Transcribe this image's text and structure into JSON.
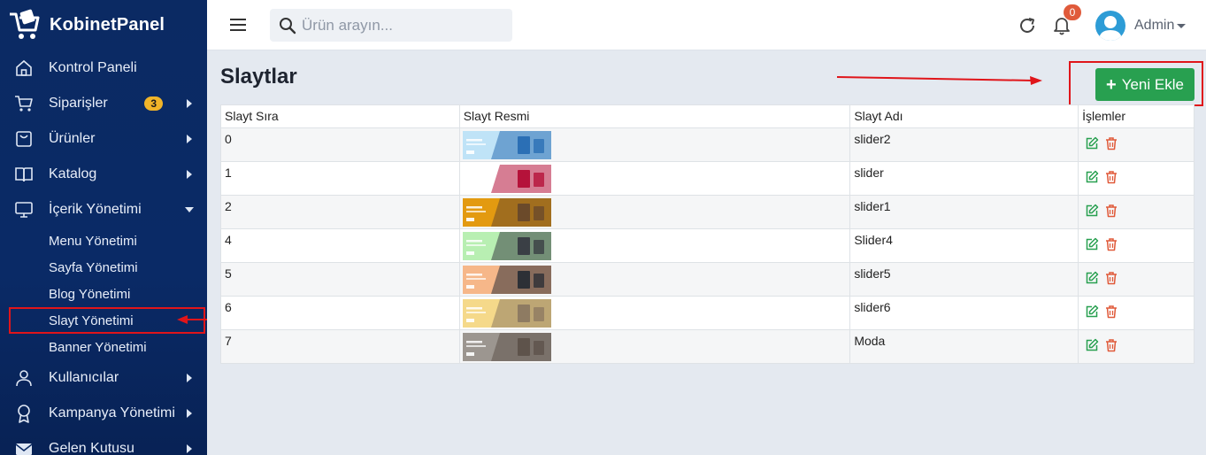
{
  "brand": {
    "name": "KobinetPanel"
  },
  "sidebar": {
    "items": [
      {
        "label": "Kontrol Paneli",
        "icon": "home-icon"
      },
      {
        "label": "Siparişler",
        "icon": "cart-icon",
        "badge": "3"
      },
      {
        "label": "Ürünler",
        "icon": "shopping-bag-icon"
      },
      {
        "label": "Katalog",
        "icon": "book-icon"
      },
      {
        "label": "İçerik Yönetimi",
        "icon": "monitor-icon",
        "expanded": true
      },
      {
        "label": "Kullanıcılar",
        "icon": "user-icon"
      },
      {
        "label": "Kampanya Yönetimi",
        "icon": "award-icon"
      },
      {
        "label": "Gelen Kutusu",
        "icon": "mail-icon"
      }
    ],
    "sub_items": [
      {
        "label": "Menu Yönetimi"
      },
      {
        "label": "Sayfa Yönetimi"
      },
      {
        "label": "Blog Yönetimi"
      },
      {
        "label": "Slayt Yönetimi",
        "active": true
      },
      {
        "label": "Banner Yönetimi"
      }
    ]
  },
  "topbar": {
    "search_placeholder": "Ürün arayın...",
    "notification_count": "0",
    "user_name": "Admin"
  },
  "page": {
    "title": "Slaytlar",
    "add_button_label": "Yeni Ekle"
  },
  "table": {
    "headers": [
      "Slayt Sıra",
      "Slayt Resmi",
      "Slayt Adı",
      "İşlemler"
    ],
    "rows": [
      {
        "order": "0",
        "name": "slider2",
        "thumb_color": "#bfe3f7",
        "thumb_accent": "#2b6fb5"
      },
      {
        "order": "1",
        "name": "slider",
        "thumb_color": "#ffffff",
        "thumb_accent": "#b5123a"
      },
      {
        "order": "2",
        "name": "slider1",
        "thumb_color": "#e39a10",
        "thumb_accent": "#6b4a2a"
      },
      {
        "order": "4",
        "name": "Slider4",
        "thumb_color": "#b8efb2",
        "thumb_accent": "#3a3f45"
      },
      {
        "order": "5",
        "name": "slider5",
        "thumb_color": "#f6b789",
        "thumb_accent": "#2d3036"
      },
      {
        "order": "6",
        "name": "slider6",
        "thumb_color": "#f5d98a",
        "thumb_accent": "#8e7b62"
      },
      {
        "order": "7",
        "name": "Moda",
        "thumb_color": "#9c9690",
        "thumb_accent": "#5e534b"
      }
    ]
  },
  "colors": {
    "sidebar_bg": "#0b2a63",
    "accent_green": "#28a050",
    "edit_icon": "#28a050",
    "delete_icon": "#e05a3a",
    "annotation_red": "#e0151a"
  }
}
